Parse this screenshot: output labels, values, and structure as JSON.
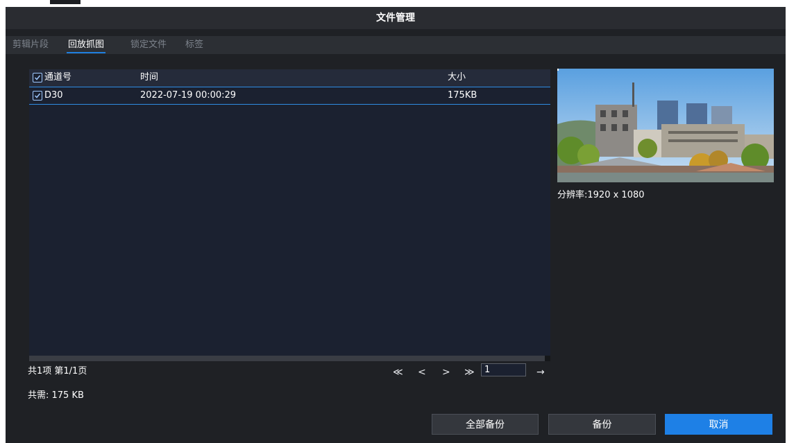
{
  "dialog": {
    "title": "文件管理"
  },
  "tabs": [
    {
      "label": "剪辑片段",
      "active": false
    },
    {
      "label": "回放抓图",
      "active": true
    },
    {
      "label": "锁定文件",
      "active": false
    },
    {
      "label": "标签",
      "active": false
    }
  ],
  "table": {
    "columns": [
      "通道号",
      "时间",
      "大小"
    ],
    "select_all_checked": true,
    "rows": [
      {
        "checked": true,
        "channel": "D30",
        "time": "2022-07-19 00:00:29",
        "size": "175KB"
      }
    ]
  },
  "preview": {
    "resolution": "分辨率:1920 x 1080"
  },
  "footer": {
    "summary": "共1项 第1/1页",
    "total_size": "共需: 175 KB"
  },
  "pagination": {
    "first": "≪",
    "prev": "<",
    "next": ">",
    "last": "≫",
    "page_value": "1",
    "go": "→"
  },
  "buttons": {
    "backup_all": "全部备份",
    "backup": "备份",
    "cancel": "取消"
  },
  "colors": {
    "accent": "#1e80e6",
    "dialog_bg": "#1f2125",
    "list_bg": "#1b2130"
  }
}
